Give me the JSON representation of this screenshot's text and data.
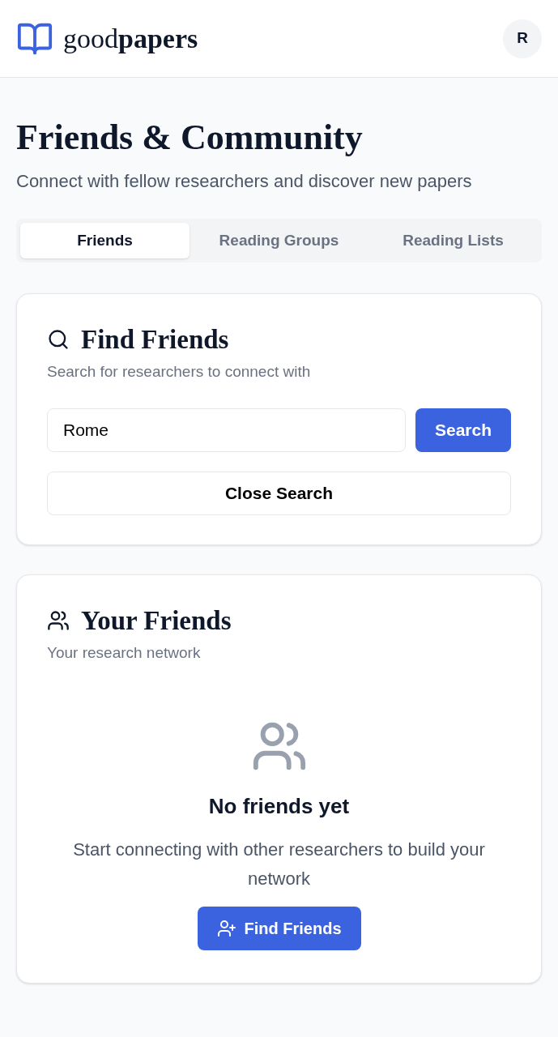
{
  "header": {
    "brand": "good**papers**",
    "avatar": "R"
  },
  "page": {
    "title": "Friends & Community",
    "subtitle": "Connect with fellow researchers and discover new papers"
  },
  "tabs": [
    {
      "label": "Friends",
      "selected": true
    },
    {
      "label": "Reading Groups",
      "selected": false
    },
    {
      "label": "Reading Lists",
      "selected": false
    }
  ],
  "find_friends": {
    "title": "Find Friends",
    "description": "Search for researchers to connect with",
    "search_field": {
      "value": "Rome"
    },
    "search_button": "Search",
    "close_button": "Close Search"
  },
  "your_friends": {
    "title": "Your Friends",
    "description": "Your research network",
    "empty_state": {
      "title": "No friends yet",
      "message": "Start connecting with other researchers to build your network",
      "button": "Find Friends"
    }
  }
}
